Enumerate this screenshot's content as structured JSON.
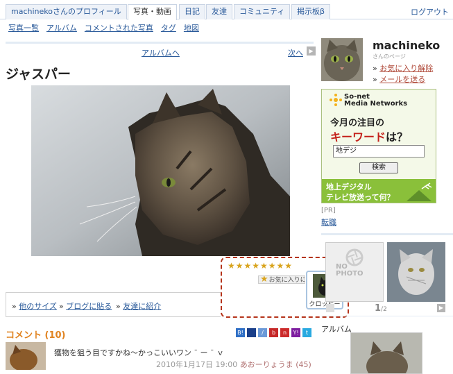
{
  "nav": {
    "tabs": [
      "machinekoさんのプロフィール",
      "写真・動画",
      "日記",
      "友達",
      "コミュニティ",
      "掲示板β"
    ],
    "logout": "ログアウト"
  },
  "subnav": [
    "写真一覧",
    "アルバム",
    "コメントされた写真",
    "タグ",
    "地図"
  ],
  "photo": {
    "album_link": "アルバムへ",
    "next_link": "次へ",
    "title": "ジャスパー",
    "stars": "★★★★★★★★",
    "fav_button": "お気に入りに追加",
    "popup_label": "クロッピー"
  },
  "actions": [
    "他のサイズ",
    "ブログに貼る",
    "友達に紹介"
  ],
  "comments": {
    "header": "コメント (10)",
    "items": [
      {
        "text": "獲物を狙う目ですかね〜かっこいいワン ˉ ー ˉ ｖ",
        "date": "2010年1月17日 19:00",
        "author": "あおーりょうま",
        "count": "(45)"
      }
    ]
  },
  "profile": {
    "name": "machineko",
    "subtitle": "さんのページ",
    "link_fav_remove": "お気に入り解除",
    "link_mail": "メールを送る"
  },
  "ad": {
    "logo_line1": "So-net",
    "logo_line2": "Media Networks",
    "line1": "今月の注目の",
    "line2_kw": "キーワード",
    "line2_suffix": "は？",
    "input_value": "地デジ",
    "button": "検索",
    "banner1": "地上デジタル",
    "banner2": "テレビ放送って何？"
  },
  "sidebar": {
    "pr": "[PR]",
    "pr_link": "転職",
    "nophoto_1": "NO",
    "nophoto_2": "PHOTO",
    "pager_current": "1",
    "pager_total": "/2",
    "album_label": "アルバム"
  }
}
